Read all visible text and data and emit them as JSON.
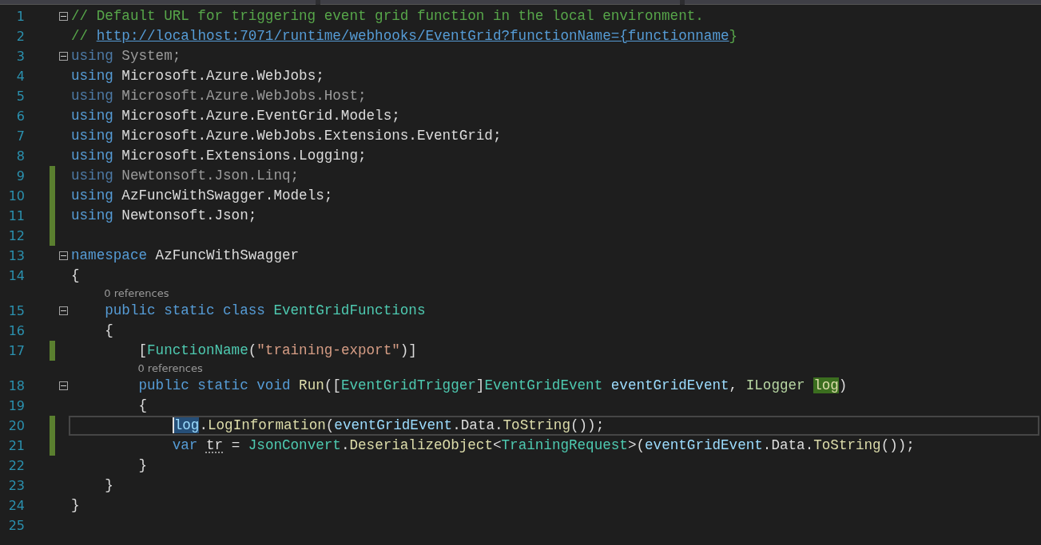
{
  "lines": [
    {
      "kind": "code",
      "number": "1",
      "changed": false,
      "fold": true,
      "current": false,
      "tokens": [
        {
          "kind": "comment",
          "text": "// Default URL for triggering event grid function in the local environment."
        }
      ]
    },
    {
      "kind": "code",
      "number": "2",
      "changed": false,
      "fold": false,
      "current": false,
      "tokens": [
        {
          "kind": "comment",
          "text": "// "
        },
        {
          "kind": "link",
          "text": "http://localhost:7071/runtime/webhooks/EventGrid?functionName={functionname"
        },
        {
          "kind": "comment",
          "text": "}"
        }
      ]
    },
    {
      "kind": "code",
      "number": "3",
      "changed": false,
      "fold": true,
      "current": false,
      "tokens": [
        {
          "kind": "unused-keyword",
          "text": "using"
        },
        {
          "kind": "unused",
          "text": " System;"
        }
      ]
    },
    {
      "kind": "code",
      "number": "4",
      "changed": false,
      "fold": false,
      "current": false,
      "tokens": [
        {
          "kind": "keyword",
          "text": "using"
        },
        {
          "kind": "plain",
          "text": " Microsoft.Azure.WebJobs;"
        }
      ]
    },
    {
      "kind": "code",
      "number": "5",
      "changed": false,
      "fold": false,
      "current": false,
      "tokens": [
        {
          "kind": "unused-keyword",
          "text": "using"
        },
        {
          "kind": "unused",
          "text": " Microsoft.Azure.WebJobs.Host;"
        }
      ]
    },
    {
      "kind": "code",
      "number": "6",
      "changed": false,
      "fold": false,
      "current": false,
      "tokens": [
        {
          "kind": "keyword",
          "text": "using"
        },
        {
          "kind": "plain",
          "text": " Microsoft.Azure.EventGrid.Models;"
        }
      ]
    },
    {
      "kind": "code",
      "number": "7",
      "changed": false,
      "fold": false,
      "current": false,
      "tokens": [
        {
          "kind": "keyword",
          "text": "using"
        },
        {
          "kind": "plain",
          "text": " Microsoft.Azure.WebJobs.Extensions.EventGrid;"
        }
      ]
    },
    {
      "kind": "code",
      "number": "8",
      "changed": false,
      "fold": false,
      "current": false,
      "tokens": [
        {
          "kind": "keyword",
          "text": "using"
        },
        {
          "kind": "plain",
          "text": " Microsoft.Extensions.Logging;"
        }
      ]
    },
    {
      "kind": "code",
      "number": "9",
      "changed": true,
      "fold": false,
      "current": false,
      "tokens": [
        {
          "kind": "unused-keyword",
          "text": "using"
        },
        {
          "kind": "unused",
          "text": " Newtonsoft.Json.Linq;"
        }
      ]
    },
    {
      "kind": "code",
      "number": "10",
      "changed": true,
      "fold": false,
      "current": false,
      "tokens": [
        {
          "kind": "keyword",
          "text": "using"
        },
        {
          "kind": "plain",
          "text": " AzFuncWithSwagger.Models;"
        }
      ]
    },
    {
      "kind": "code",
      "number": "11",
      "changed": true,
      "fold": false,
      "current": false,
      "tokens": [
        {
          "kind": "keyword",
          "text": "using"
        },
        {
          "kind": "plain",
          "text": " Newtonsoft.Json;"
        }
      ]
    },
    {
      "kind": "code",
      "number": "12",
      "changed": true,
      "fold": false,
      "current": false
    },
    {
      "kind": "code",
      "number": "13",
      "changed": false,
      "fold": true,
      "current": false,
      "tokens": [
        {
          "kind": "keyword",
          "text": "namespace"
        },
        {
          "kind": "plain",
          "text": " AzFuncWithSwagger"
        }
      ]
    },
    {
      "kind": "code",
      "number": "14",
      "changed": false,
      "fold": false,
      "current": false,
      "tokens": [
        {
          "kind": "plain",
          "text": "{"
        }
      ]
    },
    {
      "kind": "lens",
      "text": "0 references"
    },
    {
      "kind": "code",
      "number": "15",
      "changed": false,
      "fold": true,
      "current": false,
      "tokens": [
        {
          "kind": "keyword",
          "text": "public static class "
        },
        {
          "kind": "type",
          "text": "EventGridFunctions"
        }
      ]
    },
    {
      "kind": "code",
      "number": "16",
      "changed": false,
      "fold": false,
      "current": false,
      "tokens": [
        {
          "kind": "plain",
          "text": "{"
        }
      ]
    },
    {
      "kind": "code",
      "number": "17",
      "changed": true,
      "fold": false,
      "current": false,
      "tokens": [
        {
          "kind": "plain",
          "text": "["
        },
        {
          "kind": "type",
          "text": "FunctionName"
        },
        {
          "kind": "plain",
          "text": "("
        },
        {
          "kind": "string",
          "text": "\"training-export\""
        },
        {
          "kind": "plain",
          "text": ")]"
        }
      ]
    },
    {
      "kind": "lens",
      "text": "0 references"
    },
    {
      "kind": "code",
      "number": "18",
      "changed": false,
      "fold": true,
      "current": false,
      "tokens": [
        {
          "kind": "keyword",
          "text": "public static void "
        },
        {
          "kind": "method",
          "text": "Run"
        },
        {
          "kind": "plain",
          "text": "(["
        },
        {
          "kind": "type",
          "text": "EventGridTrigger"
        },
        {
          "kind": "plain",
          "text": "]"
        },
        {
          "kind": "type",
          "text": "EventGridEvent "
        },
        {
          "kind": "param",
          "text": "eventGridEvent"
        },
        {
          "kind": "plain",
          "text": ", "
        },
        {
          "kind": "interface",
          "text": "ILogger "
        },
        {
          "kind": "highlight",
          "text": "log"
        },
        {
          "kind": "plain",
          "text": ")"
        }
      ]
    },
    {
      "kind": "code",
      "number": "19",
      "changed": false,
      "fold": false,
      "current": false,
      "tokens": [
        {
          "kind": "plain",
          "text": "{"
        }
      ]
    },
    {
      "kind": "code",
      "number": "20",
      "changed": true,
      "fold": false,
      "current": true,
      "tokens": [
        {
          "kind": "selected",
          "text": "log"
        },
        {
          "kind": "plain",
          "text": "."
        },
        {
          "kind": "method",
          "text": "LogInformation"
        },
        {
          "kind": "plain",
          "text": "("
        },
        {
          "kind": "param",
          "text": "eventGridEvent"
        },
        {
          "kind": "plain",
          "text": ".Data."
        },
        {
          "kind": "method",
          "text": "ToString"
        },
        {
          "kind": "plain",
          "text": "());"
        }
      ]
    },
    {
      "kind": "code",
      "number": "21",
      "changed": true,
      "fold": false,
      "current": false,
      "tokens": [
        {
          "kind": "keyword",
          "text": "var "
        },
        {
          "kind": "hint",
          "text": "tr"
        },
        {
          "kind": "plain",
          "text": " = "
        },
        {
          "kind": "type",
          "text": "JsonConvert"
        },
        {
          "kind": "plain",
          "text": "."
        },
        {
          "kind": "method",
          "text": "DeserializeObject"
        },
        {
          "kind": "plain",
          "text": "<"
        },
        {
          "kind": "type",
          "text": "TrainingRequest"
        },
        {
          "kind": "plain",
          "text": ">("
        },
        {
          "kind": "param",
          "text": "eventGridEvent"
        },
        {
          "kind": "plain",
          "text": ".Data."
        },
        {
          "kind": "method",
          "text": "ToString"
        },
        {
          "kind": "plain",
          "text": "());"
        }
      ]
    },
    {
      "kind": "code",
      "number": "22",
      "changed": false,
      "fold": false,
      "current": false,
      "tokens": [
        {
          "kind": "plain",
          "text": "}"
        }
      ]
    },
    {
      "kind": "code",
      "number": "23",
      "changed": false,
      "fold": false,
      "current": false,
      "tokens": [
        {
          "kind": "plain",
          "text": "}"
        }
      ]
    },
    {
      "kind": "code",
      "number": "24",
      "changed": false,
      "fold": false,
      "current": false,
      "tokens": [
        {
          "kind": "plain",
          "text": "}"
        }
      ]
    },
    {
      "kind": "code",
      "number": "25",
      "changed": false,
      "fold": false,
      "current": false
    }
  ]
}
